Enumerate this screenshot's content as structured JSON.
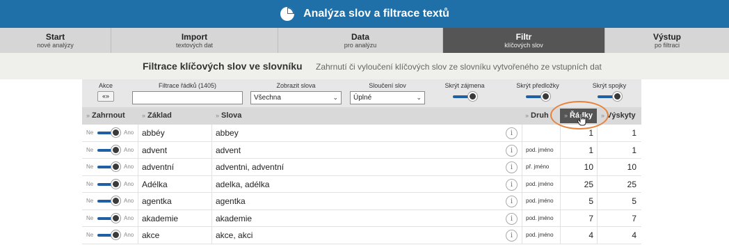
{
  "app": {
    "title": "Analýza slov a filtrace textů"
  },
  "steps": [
    {
      "title": "Start",
      "subtitle": "nové analýzy"
    },
    {
      "title": "Import",
      "subtitle": "textových dat"
    },
    {
      "title": "Data",
      "subtitle": "pro analýzu"
    },
    {
      "title": "Filtr",
      "subtitle": "klíčových slov"
    },
    {
      "title": "Výstup",
      "subtitle": "po filtraci"
    }
  ],
  "page": {
    "heading": "Filtrace klíčových slov ve slovníku",
    "description": "Zahrnutí či vyloučení klíčových slov ze slovníku vytvořeného ze vstupních dat"
  },
  "controls": {
    "akce_label": "Akce",
    "akce_button": "«»",
    "filter_label": "Filtrace řádků (1405)",
    "filter_value": "",
    "zobrazit_label": "Zobrazit slova",
    "zobrazit_value": "Všechna",
    "slouceni_label": "Sloučení slov",
    "slouceni_value": "Úplné",
    "skryt_zajmena_label": "Skrýt zájmena",
    "skryt_predlozky_label": "Skrýt předložky",
    "skryt_spojky_label": "Skrýt spojky"
  },
  "table": {
    "prefix": "»",
    "headers": {
      "zahrnout": "Zahrnout",
      "zaklad": "Základ",
      "slova": "Slova",
      "druh": "Druh",
      "radky": "Řádky",
      "vyskyty": "Výskyty"
    },
    "ne": "Ne",
    "ano": "Ano",
    "info": "i",
    "rows": [
      {
        "zaklad": "abbéy",
        "slova": "abbey",
        "druh": "",
        "radky": "1",
        "vyskyty": "1"
      },
      {
        "zaklad": "advent",
        "slova": "advent",
        "druh": "pod. jméno",
        "radky": "1",
        "vyskyty": "1"
      },
      {
        "zaklad": "adventní",
        "slova": "adventni, adventní",
        "druh": "př. jméno",
        "radky": "10",
        "vyskyty": "10"
      },
      {
        "zaklad": "Adélka",
        "slova": "adelka, adélka",
        "druh": "pod. jméno",
        "radky": "25",
        "vyskyty": "25"
      },
      {
        "zaklad": "agentka",
        "slova": "agentka",
        "druh": "pod. jméno",
        "radky": "5",
        "vyskyty": "5"
      },
      {
        "zaklad": "akademie",
        "slova": "akademie",
        "druh": "pod. jméno",
        "radky": "7",
        "vyskyty": "7"
      },
      {
        "zaklad": "akce",
        "slova": "akce, akci",
        "druh": "pod. jméno",
        "radky": "4",
        "vyskyty": "4"
      }
    ]
  },
  "colors": {
    "header_blue": "#1f6fa8",
    "active_step": "#555555",
    "toggle_blue": "#1f5fa6",
    "highlight_orange": "#e8823a"
  }
}
